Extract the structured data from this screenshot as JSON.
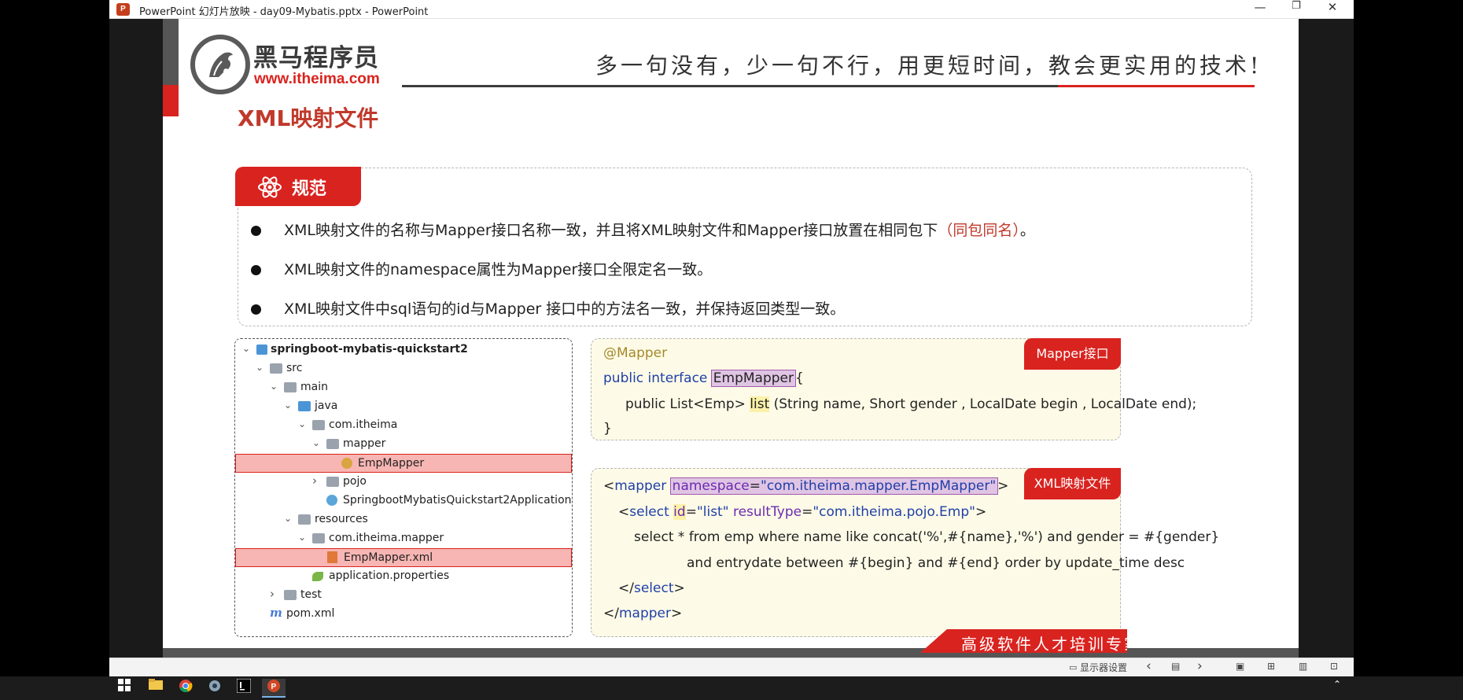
{
  "window": {
    "app_icon": "P",
    "title": "PowerPoint 幻灯片放映  -  day09-Mybatis.pptx - PowerPoint",
    "minimize": "—",
    "restore": "❐",
    "close": "✕"
  },
  "slide": {
    "logo_cn": "黑马程序员",
    "logo_url": "www.itheima.com",
    "slogan": "多一句没有，少一句不行，用更短时间，教会更实用的技术!",
    "heading": "XML映射文件",
    "spec_label": "规范",
    "bullets": [
      {
        "text": "XML映射文件的名称与Mapper接口名称一致，并且将XML映射文件和Mapper接口放置在相同包下",
        "highlight": "（同包同名）",
        "tail": "。"
      },
      {
        "text": "XML映射文件的namespace属性为Mapper接口全限定名一致。",
        "highlight": "",
        "tail": ""
      },
      {
        "text": "XML映射文件中sql语句的id与Mapper 接口中的方法名一致，并保持返回类型一致。",
        "highlight": "",
        "tail": ""
      }
    ],
    "tree": [
      {
        "label": "springboot-mybatis-quickstart2",
        "chev": "⌄"
      },
      {
        "label": "src",
        "chev": "⌄"
      },
      {
        "label": "main",
        "chev": "⌄"
      },
      {
        "label": "java",
        "chev": "⌄"
      },
      {
        "label": "com.itheima",
        "chev": "⌄"
      },
      {
        "label": "mapper",
        "chev": "⌄"
      },
      {
        "label": "EmpMapper",
        "chev": ""
      },
      {
        "label": "pojo",
        "chev": "›"
      },
      {
        "label": "SpringbootMybatisQuickstart2Application",
        "chev": ""
      },
      {
        "label": "resources",
        "chev": "⌄"
      },
      {
        "label": "com.itheima.mapper",
        "chev": "⌄"
      },
      {
        "label": "EmpMapper.xml",
        "chev": ""
      },
      {
        "label": "application.properties",
        "chev": ""
      },
      {
        "label": "test",
        "chev": "›"
      },
      {
        "label": "pom.xml",
        "chev": ""
      }
    ],
    "mapper_tag": "Mapper接口",
    "mapper_code": {
      "annotation": "@Mapper",
      "l2_kw": "public interface ",
      "l2_name": "EmpMapper",
      "l2_tail": "{",
      "l3_a": "public List<Emp> ",
      "l3_method": "list",
      "l3_b": " (String name, Short gender , LocalDate begin , LocalDate end);",
      "l4": "}"
    },
    "xml_tag": "XML映射文件",
    "xml_code": {
      "l1_open": "<",
      "l1_tag": "mapper",
      "l1_attr": "namespace",
      "l1_eq": "=",
      "l1_val": "\"com.itheima.mapper.EmpMapper\"",
      "l1_close": ">",
      "l2_open": "<",
      "l2_tag": "select",
      "l2_attr_id": "id",
      "l2_eq1": "=",
      "l2_val_id": "\"list\"",
      "l2_attr_rt": " resultType",
      "l2_eq2": "=",
      "l2_val_rt": "\"com.itheima.pojo.Emp\"",
      "l2_close": ">",
      "l3": "select * from emp where name like concat('%',#{name},'%') and gender = #{gender}",
      "l4": "and entrydate between #{begin} and #{end} order by update_time desc",
      "l5_open": "</",
      "l5_tag": "select",
      "l5_close": ">",
      "l6_open": "</",
      "l6_tag": "mapper",
      "l6_close": ">"
    },
    "footer": "高级软件人才培训专家"
  },
  "statusbar": {
    "display_settings": "显示器设置",
    "prev": "‹",
    "next": "›"
  },
  "colors": {
    "accent_red": "#d9231f",
    "code_bg": "#fdfbe7",
    "keyword": "#1f3fa8",
    "attribute": "#6b2bb0"
  }
}
